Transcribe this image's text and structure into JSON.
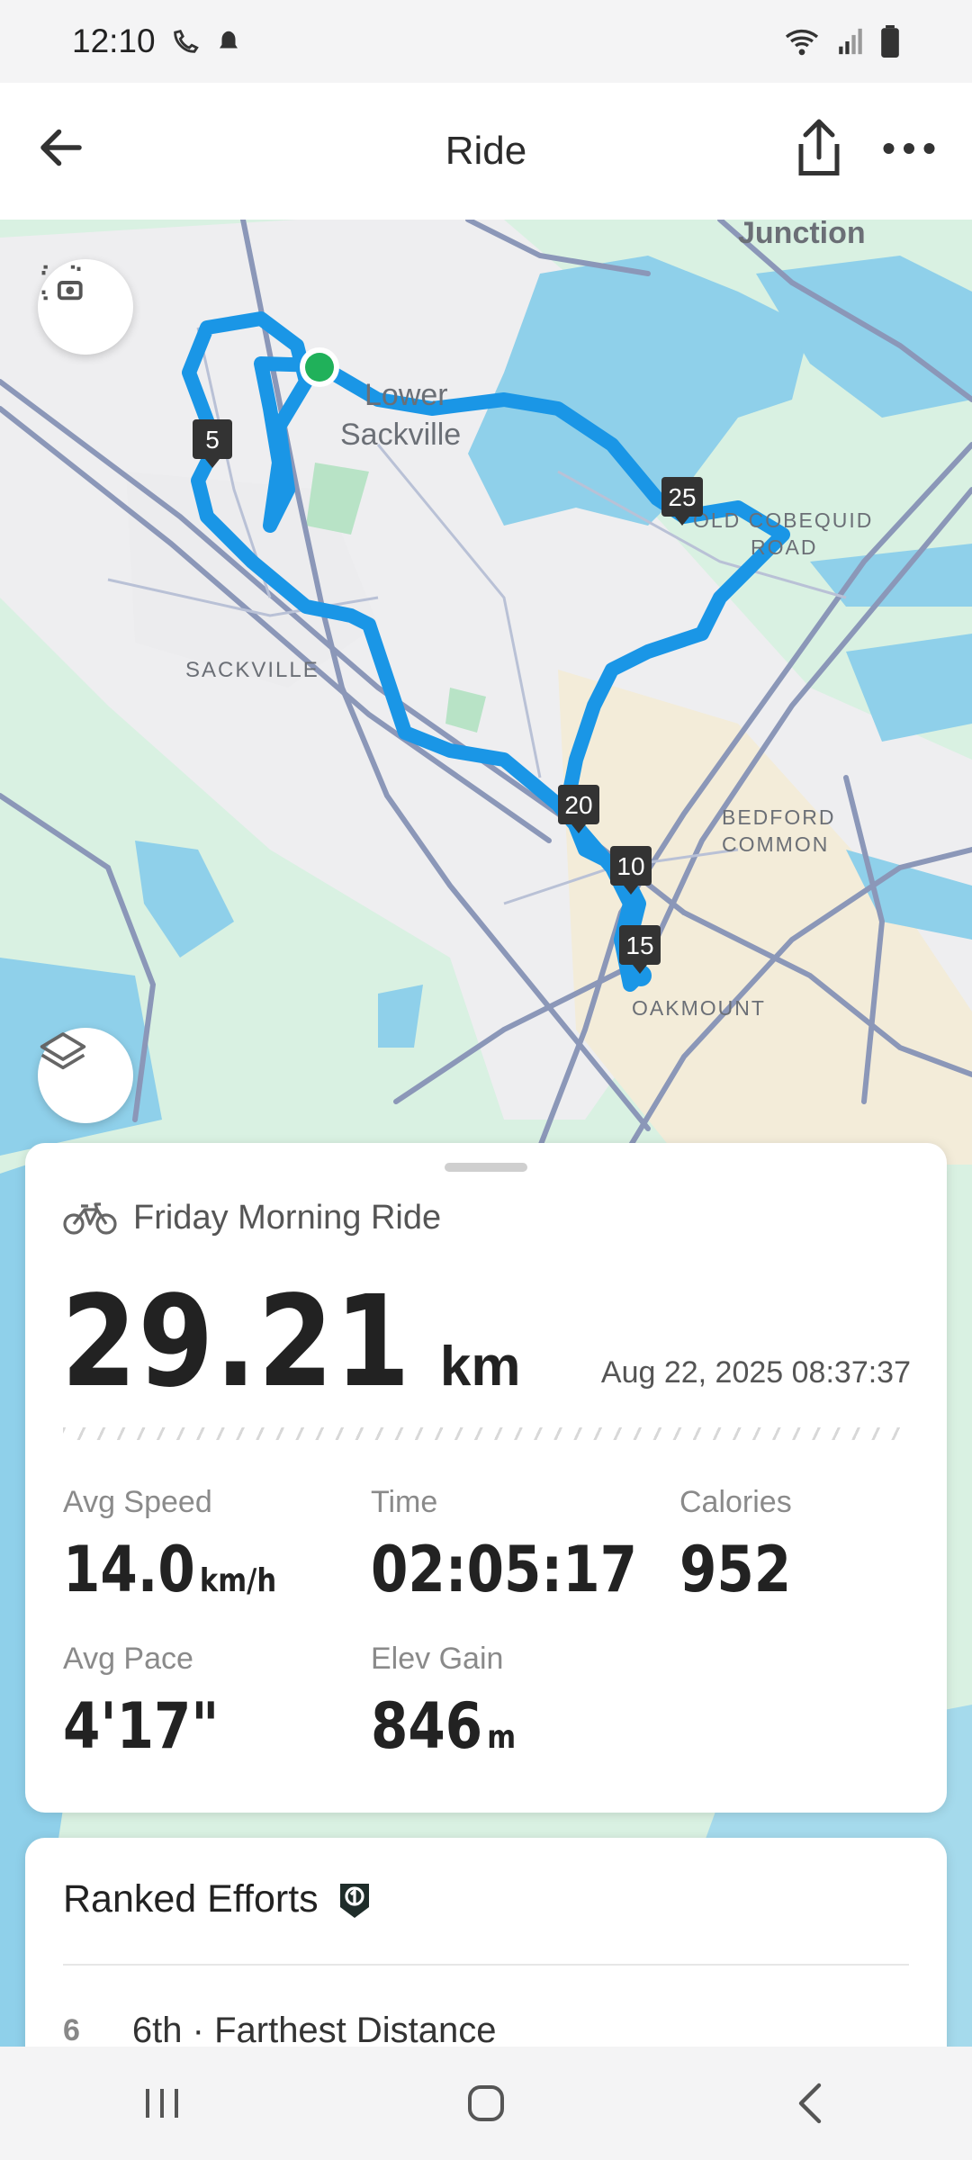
{
  "status_bar": {
    "time": "12:10",
    "left_icons": [
      "phone-missed-icon",
      "notification-icon"
    ],
    "right_icons": [
      "wifi-icon",
      "signal-icon",
      "battery-icon"
    ]
  },
  "top_bar": {
    "title": "Ride",
    "back_icon": "arrow-left-icon",
    "share_icon": "share-icon",
    "more_icon": "more-horizontal-icon"
  },
  "map": {
    "labels": {
      "junction": "Junction",
      "lower_sackville_1": "Lower",
      "lower_sackville_2": "Sackville",
      "sackville": "SACKVILLE",
      "old_cobequid_1": "OLD COBEQUID",
      "old_cobequid_2": "ROAD",
      "bedford_1": "BEDFORD",
      "bedford_2": "COMMON",
      "oakmount": "OAKMOUNT"
    },
    "km_markers": [
      "5",
      "10",
      "15",
      "20",
      "25"
    ],
    "route_color": "#1a96e6",
    "start_color": "#20b15a",
    "screenshot_icon": "screenshot-icon",
    "layers_icon": "layers-icon"
  },
  "summary": {
    "activity_icon": "bicycle-icon",
    "activity_name": "Friday Morning Ride",
    "distance_value": "29.21",
    "distance_unit": "km",
    "datetime": "Aug 22, 2025 08:37:37",
    "stats": {
      "avg_speed": {
        "label": "Avg Speed",
        "value": "14.0",
        "unit": "km/h"
      },
      "time": {
        "label": "Time",
        "value": "02:05:17"
      },
      "calories": {
        "label": "Calories",
        "value": "952"
      },
      "avg_pace": {
        "label": "Avg Pace",
        "value": "4'17\""
      },
      "elev_gain": {
        "label": "Elev Gain",
        "value": "846",
        "unit": "m"
      }
    }
  },
  "ranked_efforts": {
    "title": "Ranked Efforts",
    "badge_icon": "ranked-badge-icon",
    "items": [
      {
        "rank": "6",
        "label": "6th · Farthest Distance"
      }
    ]
  },
  "nav_bar": {
    "icons": [
      "recent-apps-icon",
      "home-icon",
      "back-icon"
    ]
  }
}
